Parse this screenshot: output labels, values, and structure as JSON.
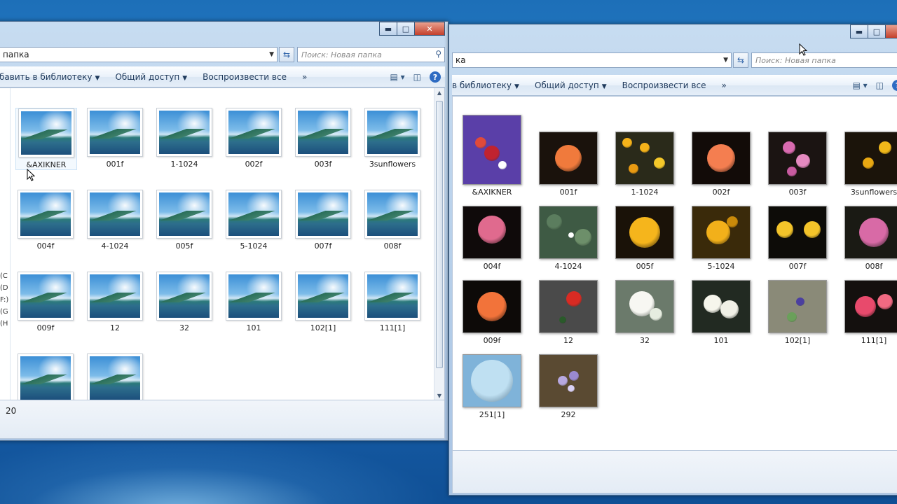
{
  "left_window": {
    "address": "папка",
    "search_placeholder": "Поиск: Новая папка",
    "toolbar": {
      "library": "бавить в библиотеку",
      "share": "Общий доступ",
      "play_all": "Воспроизвести все",
      "more": "»"
    },
    "nav_letters": [
      "(C",
      "(D",
      "F:)",
      "(G",
      "(H"
    ],
    "items": [
      "&AXIKNER",
      "001f",
      "1-1024",
      "002f",
      "003f",
      "3sunflowers",
      "004f",
      "4-1024",
      "005f",
      "5-1024",
      "007f",
      "008f",
      "009f",
      "12",
      "32",
      "101",
      "102[1]",
      "111[1]",
      "",
      ""
    ],
    "status_count": "20"
  },
  "right_window": {
    "address": "ка",
    "search_placeholder": "Поиск: Новая папка",
    "toolbar": {
      "library": "в библиотеку",
      "share": "Общий доступ",
      "play_all": "Воспроизвести все",
      "more": "»"
    },
    "items": [
      "&AXIKNER",
      "001f",
      "1-1024",
      "002f",
      "003f",
      "3sunflowers",
      "004f",
      "4-1024",
      "005f",
      "5-1024",
      "007f",
      "008f",
      "009f",
      "12",
      "32",
      "101",
      "102[1]",
      "111[1]",
      "251[1]",
      "292"
    ]
  },
  "title_buttons": {
    "minimize": "▬",
    "maximize": "□",
    "close": "✕"
  },
  "colors": {
    "accent": "#2e6bc2",
    "desktop": "#1d6fb8"
  }
}
